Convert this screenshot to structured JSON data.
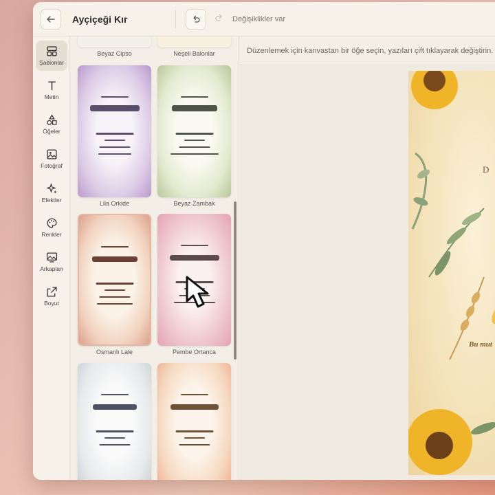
{
  "header": {
    "back_icon": "arrow-left-icon",
    "title": "Ayçiçeği Kır",
    "undo_icon": "undo-icon",
    "redo_icon": "redo-icon",
    "status": "Değişiklikler var"
  },
  "rail": {
    "items": [
      {
        "label": "Şablonlar",
        "icon": "templates-icon"
      },
      {
        "label": "Metin",
        "icon": "text-icon"
      },
      {
        "label": "Öğeler",
        "icon": "shapes-icon"
      },
      {
        "label": "Fotoğraf",
        "icon": "image-icon"
      },
      {
        "label": "Efektler",
        "icon": "sparkle-icon"
      },
      {
        "label": "Renkler",
        "icon": "palette-icon"
      },
      {
        "label": "Arkaplan",
        "icon": "background-icon"
      },
      {
        "label": "Boyut",
        "icon": "resize-icon"
      }
    ]
  },
  "templates": {
    "items": [
      {
        "label": "Beyaz Cipso"
      },
      {
        "label": "Neşeli Balonlar"
      },
      {
        "label": "Lila Orkide",
        "accent": "#5a4f6a"
      },
      {
        "label": "Beyaz Zambak",
        "accent": "#4f5546"
      },
      {
        "label": "Osmanlı Lale",
        "accent": "#6a4036"
      },
      {
        "label": "Pembe Ortanca",
        "accent": "#5b4a4e"
      },
      {
        "label": "",
        "accent": "#4e5260"
      },
      {
        "label": "",
        "accent": "#6e5238"
      }
    ]
  },
  "main": {
    "hint": "Düzenlemek için kanvastan bir öğe seçin, yazıları çift tıklayarak değiştirin.",
    "canvas_fragments": [
      "D ü",
      "Bu mut"
    ]
  }
}
